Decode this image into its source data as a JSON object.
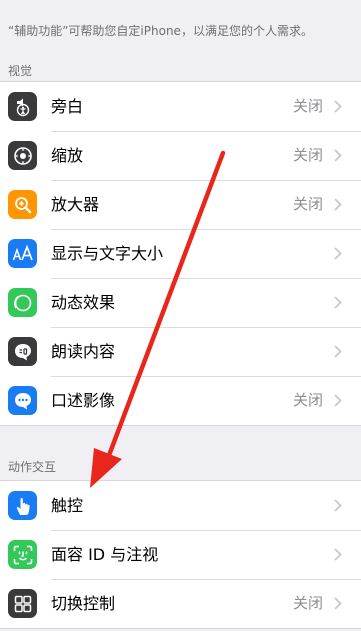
{
  "intro_text": "“辅助功能”可帮助您自定iPhone，以满足您的个人需求。",
  "sections": [
    {
      "header": "视觉",
      "items": [
        {
          "label": "旁白",
          "value": "关闭",
          "icon": "voiceover-icon",
          "icon_bg": "#3a3a3c"
        },
        {
          "label": "缩放",
          "value": "关闭",
          "icon": "zoom-icon",
          "icon_bg": "#3a3a3c"
        },
        {
          "label": "放大器",
          "value": "关闭",
          "icon": "magnifier-icon",
          "icon_bg": "#ff9500"
        },
        {
          "label": "显示与文字大小",
          "value": "",
          "icon": "text-size-icon",
          "icon_bg": "#1a7cf3"
        },
        {
          "label": "动态效果",
          "value": "",
          "icon": "motion-icon",
          "icon_bg": "#34c759"
        },
        {
          "label": "朗读内容",
          "value": "",
          "icon": "spoken-content-icon",
          "icon_bg": "#3a3a3c"
        },
        {
          "label": "口述影像",
          "value": "关闭",
          "icon": "audio-description-icon",
          "icon_bg": "#1a7cf3"
        }
      ]
    },
    {
      "header": "动作交互",
      "items": [
        {
          "label": "触控",
          "value": "",
          "icon": "touch-icon",
          "icon_bg": "#1a7cf3"
        },
        {
          "label": "面容 ID 与注视",
          "value": "",
          "icon": "face-id-icon",
          "icon_bg": "#34c759"
        },
        {
          "label": "切换控制",
          "value": "关闭",
          "icon": "switch-control-icon",
          "icon_bg": "#3a3a3c"
        }
      ]
    }
  ],
  "annotation": {
    "color": "#e8261c"
  }
}
